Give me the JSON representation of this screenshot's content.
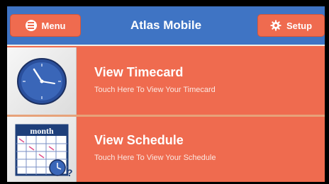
{
  "header": {
    "title": "Atlas Mobile",
    "menu_label": "Menu",
    "setup_label": "Setup",
    "menu_icon": "hamburger-icon",
    "setup_icon": "gear-icon"
  },
  "items": [
    {
      "title": "View Timecard",
      "subtitle": "Touch Here To View Your Timecard",
      "icon": "clock-icon"
    },
    {
      "title": "View Schedule",
      "subtitle": "Touch Here To View Your Schedule",
      "icon": "calendar-icon",
      "icon_text": "month"
    }
  ],
  "colors": {
    "header": "#3f74c4",
    "accent": "#ef6b4f",
    "text": "#ffffff"
  }
}
